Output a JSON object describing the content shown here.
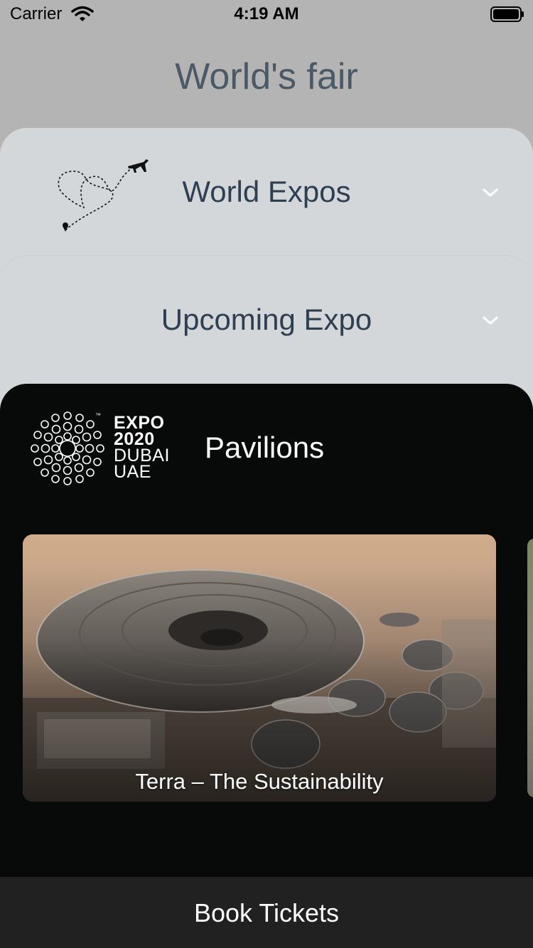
{
  "status_bar": {
    "carrier": "Carrier",
    "time": "4:19 AM"
  },
  "page": {
    "title": "World's fair"
  },
  "cards": {
    "world_expos": {
      "title": "World Expos",
      "icon": "heart-plane-icon"
    },
    "upcoming_expo": {
      "title": "Upcoming Expo"
    },
    "pavilions": {
      "title": "Pavilions",
      "logo": {
        "lines": [
          "EXPO",
          "2020",
          "DUBAI",
          "UAE"
        ],
        "tm": "™"
      },
      "items": [
        {
          "caption": "Terra – The Sustainability"
        }
      ]
    }
  },
  "footer": {
    "book_label": "Book Tickets"
  },
  "colors": {
    "background": "#b4b4b4",
    "card": "#d4d7da",
    "dark_card": "#080a0a",
    "title_text": "#2f3f52",
    "footer": "#212121"
  }
}
